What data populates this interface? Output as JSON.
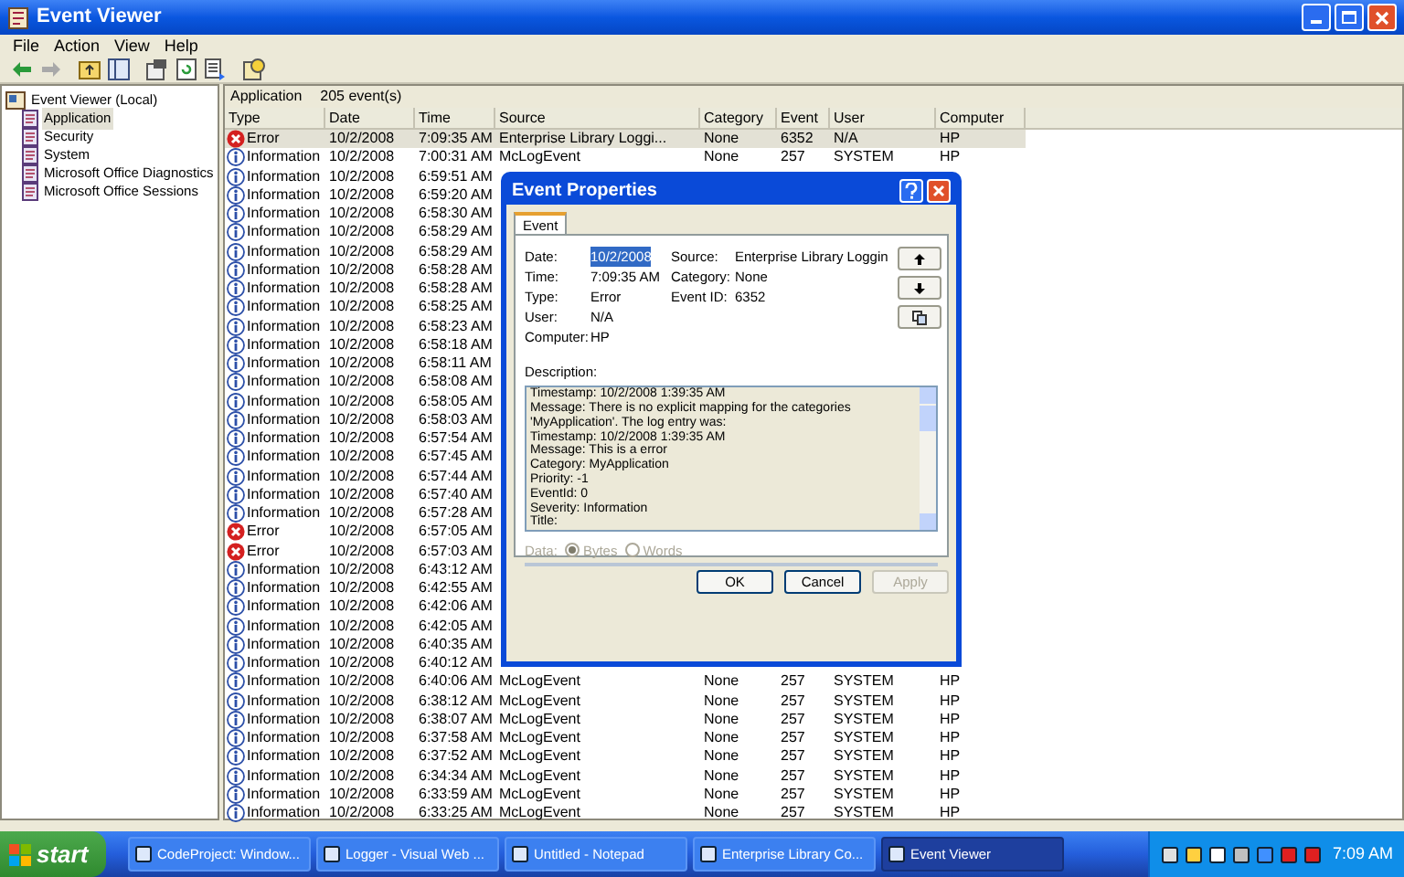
{
  "window": {
    "title": "Event Viewer"
  },
  "menu": [
    "File",
    "Action",
    "View",
    "Help"
  ],
  "tree": {
    "label": "Event Viewer (Local)",
    "children": [
      {
        "label": "Application",
        "selected": true
      },
      {
        "label": "Security",
        "selected": false
      },
      {
        "label": "System",
        "selected": false
      },
      {
        "label": "Microsoft Office Diagnostics",
        "selected": false
      },
      {
        "label": "Microsoft Office Sessions",
        "selected": false
      }
    ]
  },
  "list_header": {
    "name": "Application",
    "count": "205 event(s)"
  },
  "table": {
    "columns": [
      "Type",
      "Date",
      "Time",
      "Source",
      "Category",
      "Event",
      "User",
      "Computer"
    ],
    "rows": [
      {
        "kind": "error",
        "type": "Error",
        "date": "10/2/2008",
        "time": "7:09:35 AM",
        "source": "Enterprise Library Loggi...",
        "category": "None",
        "event": "6352",
        "user": "N/A",
        "computer": "HP",
        "selected": true
      },
      {
        "kind": "information",
        "type": "Information",
        "date": "10/2/2008",
        "time": "7:00:31 AM",
        "source": "McLogEvent",
        "category": "None",
        "event": "257",
        "user": "SYSTEM",
        "computer": "HP",
        "selected": false
      },
      {
        "kind": "information",
        "type": "Information",
        "date": "10/2/2008",
        "time": "6:59:51 AM",
        "selected": false
      },
      {
        "kind": "information",
        "type": "Information",
        "date": "10/2/2008",
        "time": "6:59:20 AM",
        "selected": false
      },
      {
        "kind": "information",
        "type": "Information",
        "date": "10/2/2008",
        "time": "6:58:30 AM",
        "selected": false
      },
      {
        "kind": "information",
        "type": "Information",
        "date": "10/2/2008",
        "time": "6:58:29 AM",
        "selected": false
      },
      {
        "kind": "information",
        "type": "Information",
        "date": "10/2/2008",
        "time": "6:58:29 AM",
        "selected": false
      },
      {
        "kind": "information",
        "type": "Information",
        "date": "10/2/2008",
        "time": "6:58:28 AM",
        "selected": false
      },
      {
        "kind": "information",
        "type": "Information",
        "date": "10/2/2008",
        "time": "6:58:28 AM",
        "selected": false
      },
      {
        "kind": "information",
        "type": "Information",
        "date": "10/2/2008",
        "time": "6:58:25 AM",
        "selected": false
      },
      {
        "kind": "information",
        "type": "Information",
        "date": "10/2/2008",
        "time": "6:58:23 AM",
        "selected": false
      },
      {
        "kind": "information",
        "type": "Information",
        "date": "10/2/2008",
        "time": "6:58:18 AM",
        "selected": false
      },
      {
        "kind": "information",
        "type": "Information",
        "date": "10/2/2008",
        "time": "6:58:11 AM",
        "selected": false
      },
      {
        "kind": "information",
        "type": "Information",
        "date": "10/2/2008",
        "time": "6:58:08 AM",
        "selected": false
      },
      {
        "kind": "information",
        "type": "Information",
        "date": "10/2/2008",
        "time": "6:58:05 AM",
        "selected": false
      },
      {
        "kind": "information",
        "type": "Information",
        "date": "10/2/2008",
        "time": "6:58:03 AM",
        "selected": false
      },
      {
        "kind": "information",
        "type": "Information",
        "date": "10/2/2008",
        "time": "6:57:54 AM",
        "selected": false
      },
      {
        "kind": "information",
        "type": "Information",
        "date": "10/2/2008",
        "time": "6:57:45 AM",
        "selected": false
      },
      {
        "kind": "information",
        "type": "Information",
        "date": "10/2/2008",
        "time": "6:57:44 AM",
        "selected": false
      },
      {
        "kind": "information",
        "type": "Information",
        "date": "10/2/2008",
        "time": "6:57:40 AM",
        "selected": false
      },
      {
        "kind": "information",
        "type": "Information",
        "date": "10/2/2008",
        "time": "6:57:28 AM",
        "selected": false
      },
      {
        "kind": "error",
        "type": "Error",
        "date": "10/2/2008",
        "time": "6:57:05 AM",
        "selected": false
      },
      {
        "kind": "error",
        "type": "Error",
        "date": "10/2/2008",
        "time": "6:57:03 AM",
        "selected": false
      },
      {
        "kind": "information",
        "type": "Information",
        "date": "10/2/2008",
        "time": "6:43:12 AM",
        "selected": false
      },
      {
        "kind": "information",
        "type": "Information",
        "date": "10/2/2008",
        "time": "6:42:55 AM",
        "selected": false
      },
      {
        "kind": "information",
        "type": "Information",
        "date": "10/2/2008",
        "time": "6:42:06 AM",
        "selected": false
      },
      {
        "kind": "information",
        "type": "Information",
        "date": "10/2/2008",
        "time": "6:42:05 AM",
        "selected": false
      },
      {
        "kind": "information",
        "type": "Information",
        "date": "10/2/2008",
        "time": "6:40:35 AM",
        "selected": false
      },
      {
        "kind": "information",
        "type": "Information",
        "date": "10/2/2008",
        "time": "6:40:12 AM",
        "selected": false
      },
      {
        "kind": "information",
        "type": "Information",
        "date": "10/2/2008",
        "time": "6:40:06 AM",
        "source": "McLogEvent",
        "category": "None",
        "event": "257",
        "user": "SYSTEM",
        "computer": "HP",
        "selected": false
      },
      {
        "kind": "information",
        "type": "Information",
        "date": "10/2/2008",
        "time": "6:38:12 AM",
        "source": "McLogEvent",
        "category": "None",
        "event": "257",
        "user": "SYSTEM",
        "computer": "HP",
        "selected": false
      },
      {
        "kind": "information",
        "type": "Information",
        "date": "10/2/2008",
        "time": "6:38:07 AM",
        "source": "McLogEvent",
        "category": "None",
        "event": "257",
        "user": "SYSTEM",
        "computer": "HP",
        "selected": false
      },
      {
        "kind": "information",
        "type": "Information",
        "date": "10/2/2008",
        "time": "6:37:58 AM",
        "source": "McLogEvent",
        "category": "None",
        "event": "257",
        "user": "SYSTEM",
        "computer": "HP",
        "selected": false
      },
      {
        "kind": "information",
        "type": "Information",
        "date": "10/2/2008",
        "time": "6:37:52 AM",
        "source": "McLogEvent",
        "category": "None",
        "event": "257",
        "user": "SYSTEM",
        "computer": "HP",
        "selected": false
      },
      {
        "kind": "information",
        "type": "Information",
        "date": "10/2/2008",
        "time": "6:34:34 AM",
        "source": "McLogEvent",
        "category": "None",
        "event": "257",
        "user": "SYSTEM",
        "computer": "HP",
        "selected": false
      },
      {
        "kind": "information",
        "type": "Information",
        "date": "10/2/2008",
        "time": "6:33:59 AM",
        "source": "McLogEvent",
        "category": "None",
        "event": "257",
        "user": "SYSTEM",
        "computer": "HP",
        "selected": false
      },
      {
        "kind": "information",
        "type": "Information",
        "date": "10/2/2008",
        "time": "6:33:25 AM",
        "source": "McLogEvent",
        "category": "None",
        "event": "257",
        "user": "SYSTEM",
        "computer": "HP",
        "selected": false
      }
    ]
  },
  "dialog": {
    "title": "Event Properties",
    "tabs": [
      {
        "label": "Event",
        "selected": true
      }
    ],
    "fields_left": [
      {
        "label": "Date:",
        "value": "10/2/2008",
        "highlighted": true
      },
      {
        "label": "Time:",
        "value": "7:09:35 AM",
        "highlighted": false
      },
      {
        "label": "Type:",
        "value": "Error",
        "highlighted": false
      },
      {
        "label": "User:",
        "value": "N/A",
        "highlighted": false
      },
      {
        "label": "Computer:",
        "value": "HP",
        "highlighted": false
      }
    ],
    "fields_right": [
      {
        "label": "Source:",
        "value": "Enterprise Library Loggin"
      },
      {
        "label": "Category:",
        "value": "None"
      },
      {
        "label": "Event ID:",
        "value": "6352"
      }
    ],
    "description_label": "Description:",
    "description_lines": [
      "Timestamp: 10/2/2008 1:39:35 AM",
      "Message: There is no explicit mapping for the categories",
      "'MyApplication'. The log entry was:",
      "Timestamp: 10/2/2008 1:39:35 AM",
      "Message: This is a error",
      "Category: MyApplication",
      "Priority: -1",
      "EventId: 0",
      "Severity: Information",
      "Title:"
    ],
    "data": {
      "label": "Data:",
      "disabled": true,
      "options": [
        {
          "label": "Bytes",
          "selected": true
        },
        {
          "label": "Words",
          "selected": false
        }
      ]
    },
    "buttons": [
      {
        "label": "OK",
        "disabled": false
      },
      {
        "label": "Cancel",
        "disabled": false
      },
      {
        "label": "Apply",
        "disabled": true
      }
    ]
  },
  "taskbar": {
    "start": "start",
    "tasks": [
      {
        "label": "CodeProject: Window...",
        "selected": false
      },
      {
        "label": "Logger - Visual Web ...",
        "selected": false
      },
      {
        "label": "Untitled - Notepad",
        "selected": false
      },
      {
        "label": "Enterprise Library Co...",
        "selected": false
      },
      {
        "label": "Event Viewer",
        "selected": true
      }
    ],
    "clock": "7:09 AM"
  }
}
